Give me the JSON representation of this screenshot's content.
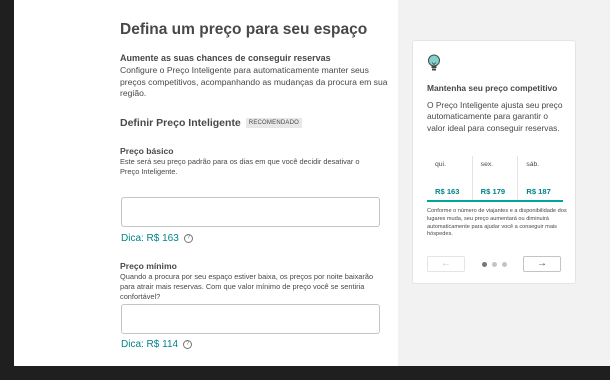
{
  "page": {
    "title": "Defina um preço para seu espaço",
    "subhead": "Aumente as suas chances de conseguir reservas",
    "intro": "Configure o Preço Inteligente para automaticamente manter seus preços competitivos, acompanhando as mudanças da procura em sua região."
  },
  "smart_pricing": {
    "title": "Definir Preço Inteligente",
    "badge": "RECOMENDADO"
  },
  "base_price": {
    "label": "Preço básico",
    "help": "Este será seu preço padrão para os dias em que você decidir desativar o Preço Inteligente.",
    "value": "",
    "tip": "Dica: R$ 163",
    "help_icon": "?"
  },
  "min_price": {
    "label": "Preço mínimo",
    "help": "Quando a procura por seu espaço estiver baixa, os preços por noite baixarão para atrair mais reservas. Com que valor mínimo de preço você se sentiria confortável?",
    "value": "",
    "tip": "Dica: R$ 114",
    "help_icon": "?"
  },
  "card": {
    "icon": "lightbulb-icon",
    "title": "Mantenha seu preço competitivo",
    "body": "O Preço Inteligente ajusta seu preço automaticamente para garantir o valor ideal para conseguir reservas.",
    "days": [
      {
        "day": "qui.",
        "price": "R$ 163"
      },
      {
        "day": "sex.",
        "price": "R$ 179"
      },
      {
        "day": "sáb.",
        "price": "R$ 187"
      }
    ],
    "note": "Conforme o número de viajantes e a disponibilidade dos lugares muda, seu preço aumentará ou diminuirá automaticamente para ajudar você a conseguir mais hóspedes.",
    "prev_arrow": "←",
    "next_arrow": "→",
    "active_slide": 1,
    "slide_count": 3
  },
  "colors": {
    "accent": "#008489",
    "teal_bar": "#00a699",
    "text": "#484848",
    "panel_bg": "#f2f2f2"
  }
}
